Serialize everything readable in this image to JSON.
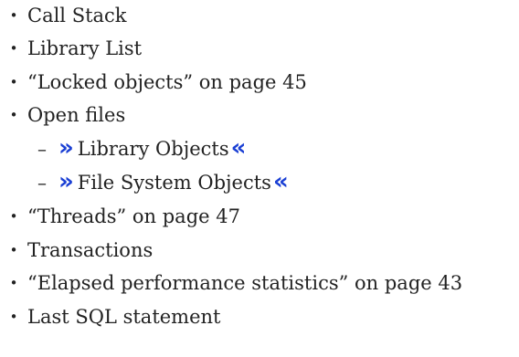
{
  "list": {
    "items": [
      {
        "text": "Call Stack"
      },
      {
        "text": "Library List"
      },
      {
        "text": "“Locked objects” on page 45"
      },
      {
        "text": "Open files"
      },
      {
        "text": "Library Objects"
      },
      {
        "text": "File System Objects"
      },
      {
        "text": "“Threads” on page 47"
      },
      {
        "text": "Transactions"
      },
      {
        "text": "“Elapsed performance statistics” on page 43"
      },
      {
        "text": "Last SQL statement"
      }
    ]
  },
  "markers": {
    "bullet": "•",
    "dash": "–",
    "change_start": "»",
    "change_end": "«"
  },
  "colors": {
    "text": "#222222",
    "change_marker": "#1a3fd4"
  }
}
